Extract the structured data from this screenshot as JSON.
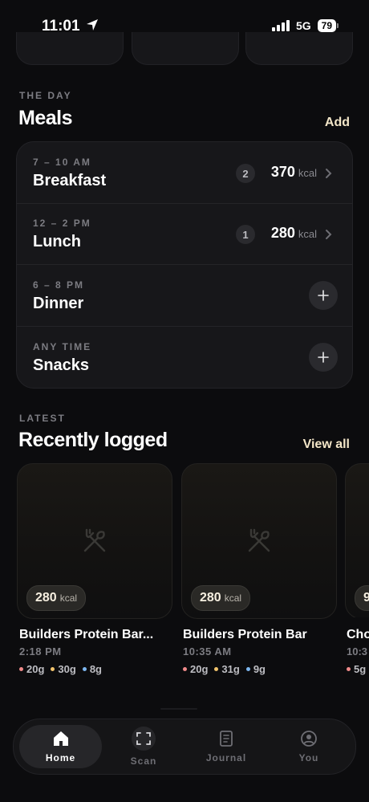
{
  "status": {
    "time": "11:01",
    "network": "5G",
    "battery": "79"
  },
  "meals": {
    "eyebrow": "THE DAY",
    "title": "Meals",
    "add_label": "Add",
    "items": [
      {
        "time": "7 – 10 AM",
        "name": "Breakfast",
        "count": "2",
        "kcal": "370",
        "unit": "kcal"
      },
      {
        "time": "12 – 2 PM",
        "name": "Lunch",
        "count": "1",
        "kcal": "280",
        "unit": "kcal"
      },
      {
        "time": "6 – 8 PM",
        "name": "Dinner"
      },
      {
        "time": "ANY TIME",
        "name": "Snacks"
      }
    ]
  },
  "recent": {
    "eyebrow": "LATEST",
    "title": "Recently logged",
    "view_all": "View all",
    "items": [
      {
        "kcal": "280",
        "unit": "kcal",
        "name": "Builders Protein Bar...",
        "time": "2:18 PM",
        "macros": [
          "20g",
          "30g",
          "8g"
        ]
      },
      {
        "kcal": "280",
        "unit": "kcal",
        "name": "Builders Protein Bar",
        "time": "10:35 AM",
        "macros": [
          "20g",
          "31g",
          "9g"
        ]
      },
      {
        "kcal": "9",
        "name": "Cho",
        "time": "10:3",
        "macros": [
          "5g"
        ]
      }
    ]
  },
  "macro_colors": {
    "protein": "#f08a8a",
    "carbs": "#f2c46d",
    "fat": "#7db7f0"
  },
  "nav": {
    "tabs": [
      {
        "label": "Home",
        "icon": "home-icon",
        "active": true
      },
      {
        "label": "Scan",
        "icon": "scan-icon"
      },
      {
        "label": "Journal",
        "icon": "journal-icon"
      },
      {
        "label": "You",
        "icon": "user-icon"
      }
    ]
  }
}
